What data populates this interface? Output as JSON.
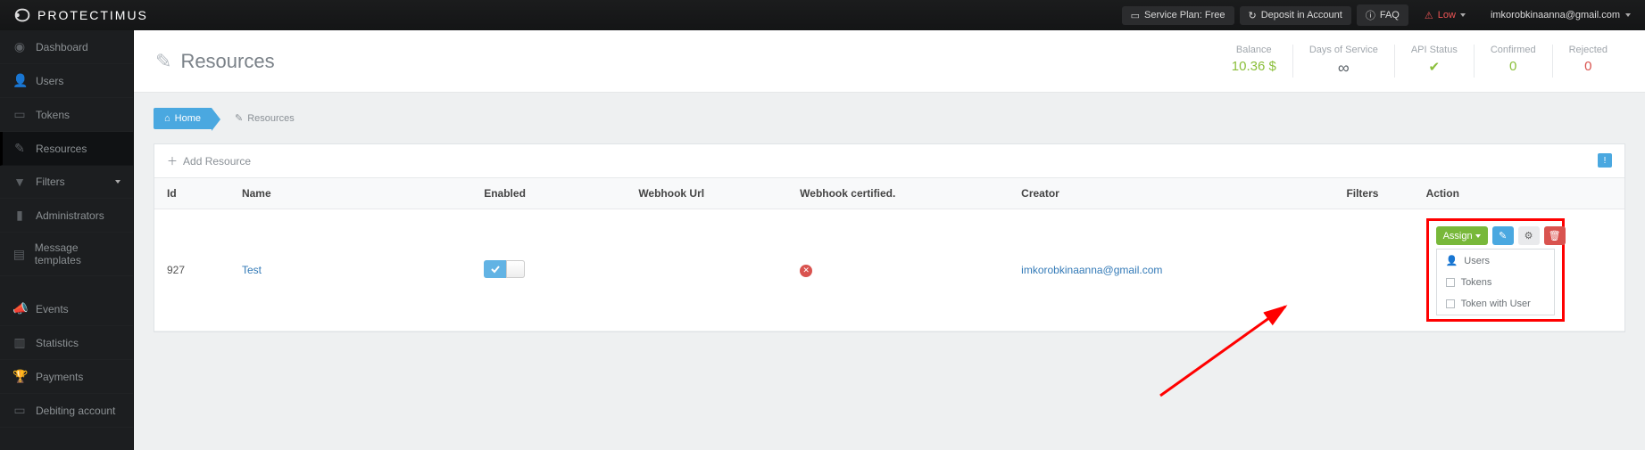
{
  "brand": "PROTECTIMUS",
  "top": {
    "service_plan": "Service Plan: Free",
    "deposit": "Deposit in Account",
    "faq": "FAQ",
    "low": "Low",
    "user_email": "imkorobkinaanna@gmail.com"
  },
  "sidebar": [
    {
      "label": "Dashboard",
      "icon": "dashboard"
    },
    {
      "label": "Users",
      "icon": "users"
    },
    {
      "label": "Tokens",
      "icon": "token"
    },
    {
      "label": "Resources",
      "icon": "resources",
      "active": true
    },
    {
      "label": "Filters",
      "icon": "filter",
      "caret": true
    },
    {
      "label": "Administrators",
      "icon": "bars"
    },
    {
      "label": "Message templates",
      "icon": "file"
    }
  ],
  "sidebar2": [
    {
      "label": "Events",
      "icon": "bullhorn"
    },
    {
      "label": "Statistics",
      "icon": "chart"
    },
    {
      "label": "Payments",
      "icon": "trophy"
    },
    {
      "label": "Debiting account",
      "icon": "receipt"
    }
  ],
  "page": {
    "title": "Resources",
    "breadcrumb_home": "Home",
    "breadcrumb_current": "Resources",
    "add_resource": "Add Resource"
  },
  "stats": {
    "balance_label": "Balance",
    "balance_value": "10.36 $",
    "days_label": "Days of Service",
    "api_label": "API Status",
    "confirmed_label": "Confirmed",
    "confirmed_value": "0",
    "rejected_label": "Rejected",
    "rejected_value": "0"
  },
  "table": {
    "headers": {
      "id": "Id",
      "name": "Name",
      "enabled": "Enabled",
      "webhook": "Webhook Url",
      "certified": "Webhook certified.",
      "creator": "Creator",
      "filters": "Filters",
      "action": "Action"
    },
    "row": {
      "id": "927",
      "name": "Test",
      "creator": "imkorobkinaanna@gmail.com"
    }
  },
  "actions": {
    "assign": "Assign",
    "menu": {
      "users": "Users",
      "tokens": "Tokens",
      "token_with_user": "Token with User"
    }
  }
}
